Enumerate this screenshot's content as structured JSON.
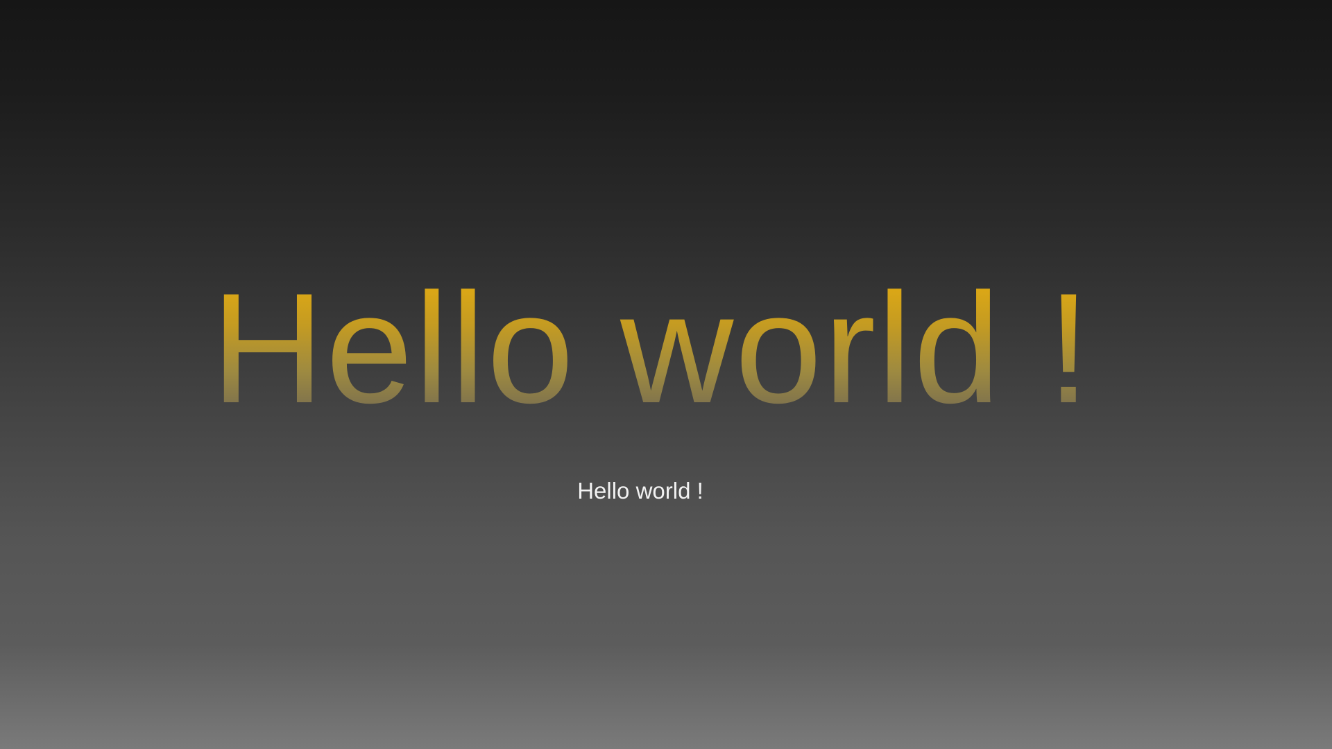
{
  "hero": {
    "title": "Hello world !",
    "title_gradient": [
      "#e6ad10",
      "#c49b22",
      "#9e8a40",
      "#6f6754"
    ]
  },
  "subtitle": {
    "text": "Hello world !",
    "color": "#f2f2f2"
  },
  "background": {
    "gradient_top": "#161616",
    "gradient_bottom": "#7a7a7a"
  }
}
